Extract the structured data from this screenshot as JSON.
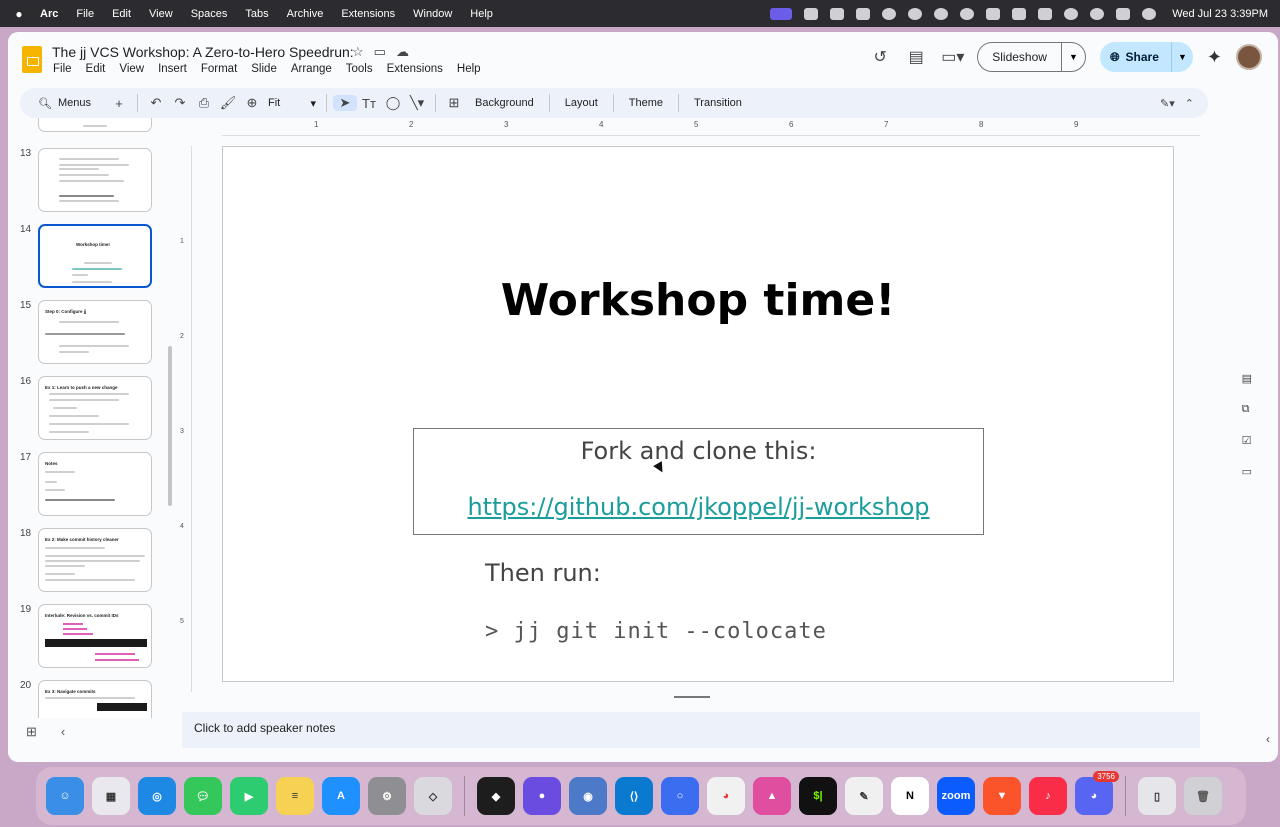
{
  "menubar": {
    "app_name": "Arc",
    "items": [
      "File",
      "Edit",
      "View",
      "Spaces",
      "Tabs",
      "Archive",
      "Extensions",
      "Window",
      "Help"
    ],
    "clock": "Wed Jul 23  3:39PM"
  },
  "doc": {
    "title": "The jj VCS Workshop: A Zero-to-Hero Speedrun:",
    "menus": [
      "File",
      "Edit",
      "View",
      "Insert",
      "Format",
      "Slide",
      "Arrange",
      "Tools",
      "Extensions",
      "Help"
    ]
  },
  "header": {
    "slideshow_label": "Slideshow",
    "share_label": "Share"
  },
  "toolbar": {
    "search_label": "Menus",
    "zoom_label": "Fit",
    "background_label": "Background",
    "layout_label": "Layout",
    "theme_label": "Theme",
    "transition_label": "Transition"
  },
  "filmstrip": {
    "thumbs": [
      {
        "num": "13",
        "title": ""
      },
      {
        "num": "14",
        "title": "Workshop time!"
      },
      {
        "num": "15",
        "title": "Step 0: Configure jj"
      },
      {
        "num": "16",
        "title": "Ex 1: Learn to push a new change"
      },
      {
        "num": "17",
        "title": "Notes"
      },
      {
        "num": "18",
        "title": "Ex 2: Make commit history cleaner"
      },
      {
        "num": "19",
        "title": "Interlude: Revision vs. commit IDs"
      },
      {
        "num": "20",
        "title": "Ex 3: Navigate commits"
      }
    ]
  },
  "ruler": {
    "h_ticks": [
      "1",
      "2",
      "3",
      "4",
      "5",
      "6",
      "7",
      "8",
      "9"
    ],
    "v_ticks": [
      "1",
      "2",
      "3",
      "4",
      "5"
    ]
  },
  "slide": {
    "title": "Workshop time!",
    "fork_label": "Fork and clone this:",
    "repo_url": "https://github.com/jkoppel/jj-workshop",
    "then_run": "Then run:",
    "command": "> jj git init --colocate"
  },
  "notes": {
    "placeholder": "Click to add speaker notes"
  },
  "dock": {
    "discord_badge": "3756"
  },
  "colors": {
    "accent": "#0b57d0",
    "link": "#1a9d9b",
    "share_bg": "#c2e7ff"
  }
}
